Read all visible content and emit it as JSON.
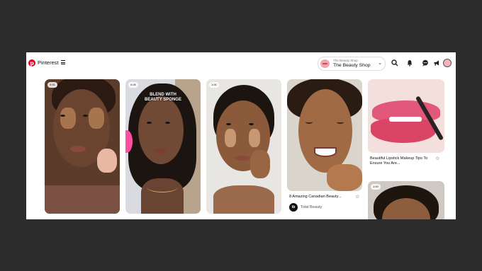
{
  "header": {
    "brand": "Pinterest",
    "account": {
      "small_label": "The Beauty Shop",
      "name": "The Beauty Shop"
    },
    "icons": [
      "search-icon",
      "notifications-icon",
      "messages-icon",
      "updates-icon",
      "profile-avatar"
    ]
  },
  "pins": [
    {
      "badge": "0:51",
      "caption": ""
    },
    {
      "badge": "0:26",
      "overlay": "BLEND WITH BEAUTY SPONGE",
      "caption": ""
    },
    {
      "badge": "1:00",
      "caption": ""
    },
    {
      "caption": "8 Amazing Canadian Beauty...",
      "source": "Total Beauty",
      "source_logo": "tb"
    },
    {
      "caption": "Beautiful Lipstick Makeup Tips To Ensure You Are..."
    },
    {
      "badge": "1:00",
      "caption": ""
    }
  ],
  "colors": {
    "accent": "#e60023",
    "background": "#2c2c2c",
    "panel": "#ffffff"
  }
}
